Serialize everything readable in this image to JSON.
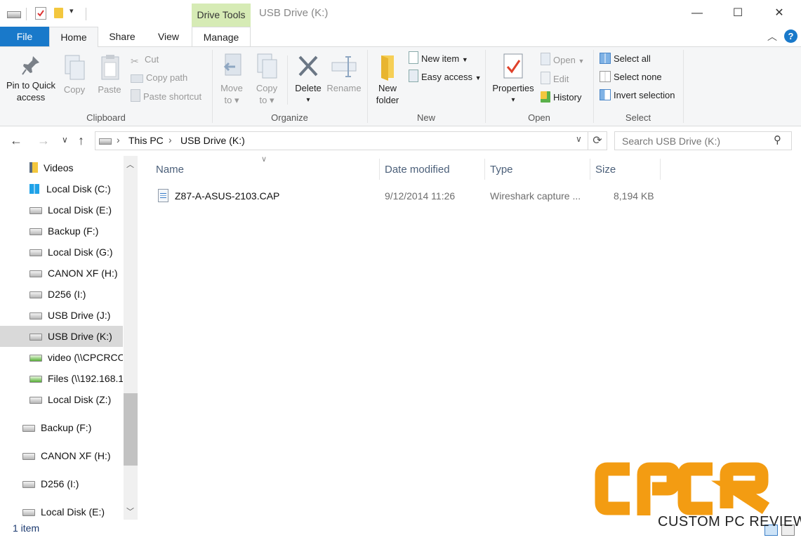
{
  "window": {
    "title": "USB Drive (K:)",
    "context_tab_group": "Drive Tools",
    "controls": {
      "minimize": "—",
      "maximize": "☐",
      "close": "✕"
    }
  },
  "tabs": [
    "File",
    "Home",
    "Share",
    "View",
    "Manage"
  ],
  "ribbon": {
    "clipboard": {
      "label": "Clipboard",
      "pin": "Pin to Quick access",
      "pin_line1": "Pin to Quick",
      "pin_line2": "access",
      "copy": "Copy",
      "paste": "Paste",
      "cut": "Cut",
      "copy_path": "Copy path",
      "paste_shortcut": "Paste shortcut"
    },
    "organize": {
      "label": "Organize",
      "move_to_1": "Move",
      "move_to_2": "to",
      "copy_to_1": "Copy",
      "copy_to_2": "to",
      "delete": "Delete",
      "rename": "Rename"
    },
    "new": {
      "label": "New",
      "new_folder_1": "New",
      "new_folder_2": "folder",
      "new_item": "New item",
      "easy_access": "Easy access"
    },
    "open": {
      "label": "Open",
      "properties": "Properties",
      "open": "Open",
      "edit": "Edit",
      "history": "History"
    },
    "select": {
      "label": "Select",
      "select_all": "Select all",
      "select_none": "Select none",
      "invert": "Invert selection"
    }
  },
  "address": {
    "crumbs": [
      "This PC",
      "USB Drive (K:)"
    ],
    "search_placeholder": "Search USB Drive (K:)"
  },
  "nav_items": [
    {
      "label": "Videos",
      "icon": "videos-folder-icon"
    },
    {
      "label": "Local Disk (C:)",
      "icon": "windows-drive-icon"
    },
    {
      "label": "Local Disk (E:)",
      "icon": "drive-icon"
    },
    {
      "label": "Backup (F:)",
      "icon": "drive-icon"
    },
    {
      "label": "Local Disk (G:)",
      "icon": "drive-icon"
    },
    {
      "label": "CANON XF (H:)",
      "icon": "drive-icon"
    },
    {
      "label": "D256 (I:)",
      "icon": "drive-icon"
    },
    {
      "label": "USB Drive (J:)",
      "icon": "drive-icon"
    },
    {
      "label": "USB Drive (K:)",
      "icon": "drive-icon",
      "selected": true
    },
    {
      "label": "video (\\\\CPCRCO",
      "icon": "network-drive-icon"
    },
    {
      "label": "Files (\\\\192.168.1",
      "icon": "network-drive-icon"
    },
    {
      "label": "Local Disk (Z:)",
      "icon": "drive-icon"
    },
    {
      "label": "Backup (F:)",
      "icon": "drive-icon"
    },
    {
      "label": "CANON XF (H:)",
      "icon": "drive-icon"
    },
    {
      "label": "D256 (I:)",
      "icon": "drive-icon"
    },
    {
      "label": "Local Disk (E:)",
      "icon": "drive-icon"
    }
  ],
  "columns": [
    "Name",
    "Date modified",
    "Type",
    "Size"
  ],
  "files": [
    {
      "name": "Z87-A-ASUS-2103.CAP",
      "date": "9/12/2014 11:26",
      "type": "Wireshark capture ...",
      "size": "8,194 KB"
    }
  ],
  "status": "1 item",
  "watermark": {
    "logo": "CPCR",
    "tagline": "CUSTOM PC REVIEW"
  },
  "colors": {
    "accent": "#1979ca",
    "drive_tools": "#d6ebb5",
    "watermark": "#f39c12"
  }
}
